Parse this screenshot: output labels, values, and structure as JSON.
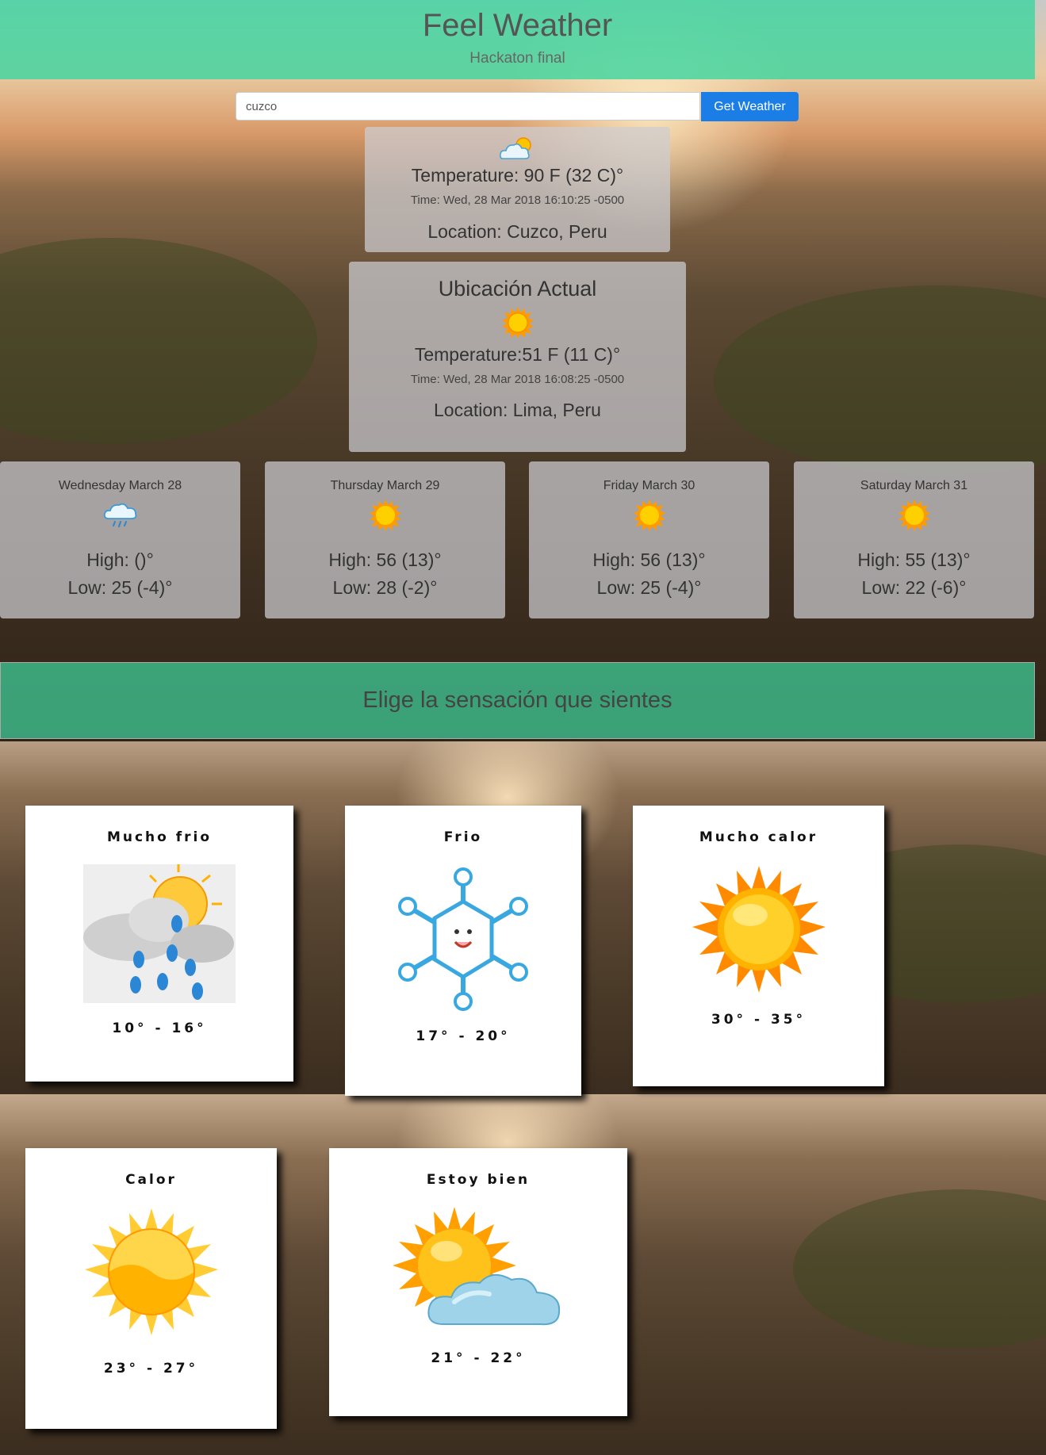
{
  "header": {
    "title": "Feel Weather",
    "subtitle": "Hackaton final"
  },
  "search": {
    "value": "cuzco",
    "button_label": "Get Weather"
  },
  "current_search": {
    "icon": "partly-cloudy-icon",
    "temperature": "Temperature: 90 F (32 C)°",
    "time": "Time: Wed, 28 Mar 2018 16:10:25 -0500",
    "location": "Location: Cuzco, Peru"
  },
  "current_location": {
    "heading": "Ubicación Actual",
    "icon": "sun-icon",
    "temperature": "Temperature:51 F (11 C)°",
    "time": "Time: Wed, 28 Mar 2018 16:08:25 -0500",
    "location": "Location: Lima, Peru"
  },
  "forecast": [
    {
      "day": "Wednesday March 28",
      "icon": "rain-cloud-icon",
      "high": "High: ()°",
      "low": "Low: 25 (-4)°"
    },
    {
      "day": "Thursday March 29",
      "icon": "sun-icon",
      "high": "High: 56 (13)°",
      "low": "Low: 28 (-2)°"
    },
    {
      "day": "Friday March 30",
      "icon": "sun-icon",
      "high": "High: 56 (13)°",
      "low": "Low: 25 (-4)°"
    },
    {
      "day": "Saturday March 31",
      "icon": "sun-icon",
      "high": "High: 55 (13)°",
      "low": "Low: 22 (-6)°"
    }
  ],
  "feelings_heading": "Elige la sensación que sientes",
  "feelings": [
    {
      "title": "Mucho frio",
      "range": "10° - 16°",
      "icon": "sun-rain-cloud-icon"
    },
    {
      "title": "Frio",
      "range": "17° - 20°",
      "icon": "snowflake-icon"
    },
    {
      "title": "Mucho calor",
      "range": "30° - 35°",
      "icon": "sun-icon"
    },
    {
      "title": "Calor",
      "range": "23° - 27°",
      "icon": "sun-icon"
    },
    {
      "title": "Estoy bien",
      "range": "21° - 22°",
      "icon": "sun-cloud-icon"
    }
  ],
  "colors": {
    "header": "#40d6a0",
    "button": "#1a7ee6",
    "sun": "#ffc400",
    "card": "#cdcdd2"
  }
}
